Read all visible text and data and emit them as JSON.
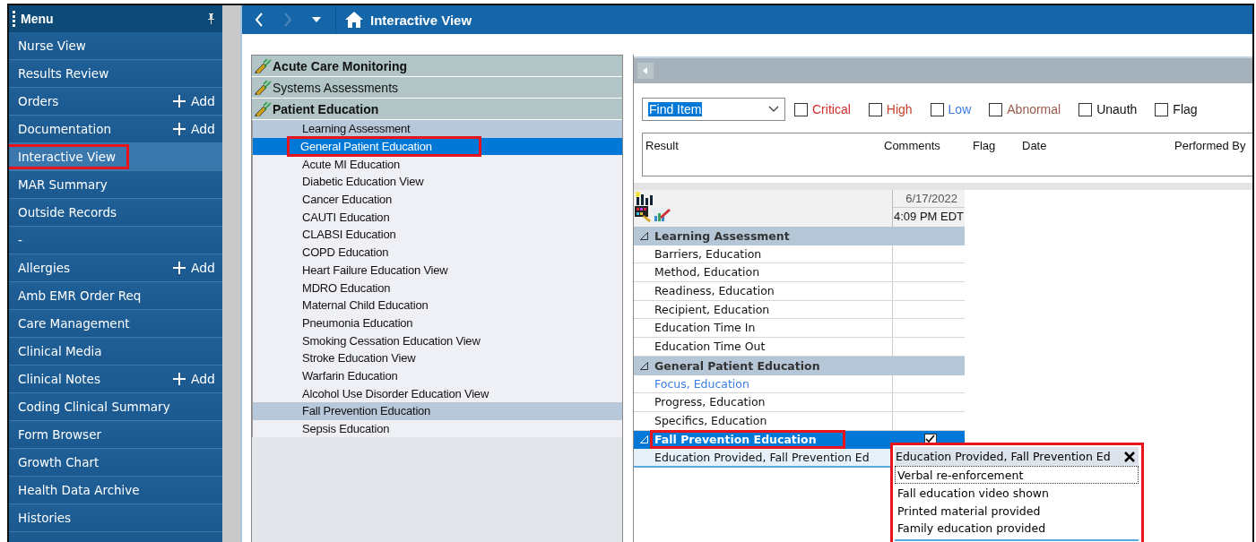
{
  "sidebar": {
    "title": "Menu",
    "items": [
      {
        "label": "Nurse View",
        "selected": false,
        "highlighted": false
      },
      {
        "label": "Results Review",
        "selected": false,
        "highlighted": false
      },
      {
        "label": "Orders",
        "add": "Add",
        "selected": false,
        "highlighted": false
      },
      {
        "label": "Documentation",
        "add": "Add",
        "selected": false,
        "highlighted": false
      },
      {
        "label": "Interactive View",
        "selected": true,
        "highlighted": true
      },
      {
        "label": "MAR Summary",
        "selected": false,
        "highlighted": false
      },
      {
        "label": "Outside Records",
        "selected": false,
        "highlighted": false
      },
      {
        "label": "-",
        "selected": false,
        "highlighted": false
      },
      {
        "label": "Allergies",
        "add": "Add",
        "selected": false,
        "highlighted": false
      },
      {
        "label": "Amb EMR Order Req",
        "selected": false,
        "highlighted": false
      },
      {
        "label": "Care Management",
        "selected": false,
        "highlighted": false
      },
      {
        "label": "Clinical Media",
        "selected": false,
        "highlighted": false
      },
      {
        "label": "Clinical Notes",
        "add": "Add",
        "selected": false,
        "highlighted": false
      },
      {
        "label": "Coding Clinical Summary",
        "selected": false,
        "highlighted": false
      },
      {
        "label": "Form Browser",
        "selected": false,
        "highlighted": false
      },
      {
        "label": "Growth Chart",
        "selected": false,
        "highlighted": false
      },
      {
        "label": "Health Data Archive",
        "selected": false,
        "highlighted": false
      },
      {
        "label": "Histories",
        "selected": false,
        "highlighted": false
      }
    ]
  },
  "toolbar": {
    "title": "Interactive View"
  },
  "bands": [
    {
      "label": "Acute Care Monitoring",
      "documented": true
    },
    {
      "label": "Systems Assessments",
      "documented": false
    },
    {
      "label": "Patient Education",
      "documented": true,
      "items": [
        {
          "label": "Learning Assessment",
          "selected": false,
          "shaded": true,
          "highlighted": false
        },
        {
          "label": "General Patient Education",
          "selected": true,
          "shaded": false,
          "highlighted": true
        },
        {
          "label": "Acute MI Education",
          "selected": false,
          "shaded": false,
          "highlighted": false
        },
        {
          "label": "Diabetic Education View",
          "selected": false,
          "shaded": false,
          "highlighted": false
        },
        {
          "label": "Cancer Education",
          "selected": false,
          "shaded": false,
          "highlighted": false
        },
        {
          "label": "CAUTI Education",
          "selected": false,
          "shaded": false,
          "highlighted": false
        },
        {
          "label": "CLABSI Education",
          "selected": false,
          "shaded": false,
          "highlighted": false
        },
        {
          "label": "COPD Education",
          "selected": false,
          "shaded": false,
          "highlighted": false
        },
        {
          "label": "Heart Failure Education View",
          "selected": false,
          "shaded": false,
          "highlighted": false
        },
        {
          "label": "MDRO Education",
          "selected": false,
          "shaded": false,
          "highlighted": false
        },
        {
          "label": "Maternal Child Education",
          "selected": false,
          "shaded": false,
          "highlighted": false
        },
        {
          "label": "Pneumonia Education",
          "selected": false,
          "shaded": false,
          "highlighted": false
        },
        {
          "label": "Smoking Cessation Education View",
          "selected": false,
          "shaded": false,
          "highlighted": false
        },
        {
          "label": "Stroke Education View",
          "selected": false,
          "shaded": false,
          "highlighted": false
        },
        {
          "label": "Warfarin Education",
          "selected": false,
          "shaded": false,
          "highlighted": false
        },
        {
          "label": "Alcohol Use Disorder Education View",
          "selected": false,
          "shaded": false,
          "highlighted": false
        },
        {
          "label": "Fall Prevention Education",
          "selected": false,
          "shaded": true,
          "highlighted": false
        },
        {
          "label": "Sepsis Education",
          "selected": false,
          "shaded": false,
          "highlighted": false
        }
      ]
    }
  ],
  "filters": {
    "find_item": {
      "value": "Find Item"
    },
    "checkboxes": [
      {
        "label": "Critical",
        "checked": false,
        "color": "#d42a2a"
      },
      {
        "label": "High",
        "checked": false,
        "color": "#c8402a"
      },
      {
        "label": "Low",
        "checked": false,
        "color": "#3b7de6"
      },
      {
        "label": "Abnormal",
        "checked": false,
        "color": "#9a5b4c"
      },
      {
        "label": "Unauth",
        "checked": false,
        "color": "#111111"
      },
      {
        "label": "Flag",
        "checked": false,
        "color": "#111111"
      }
    ]
  },
  "results_table": {
    "columns": [
      "Result",
      "Comments",
      "Flag",
      "Date",
      "Performed By"
    ]
  },
  "flowsheet": {
    "date": "6/17/2022",
    "time": "4:09 PM EDT",
    "sections": [
      {
        "title": "Learning Assessment",
        "selected": false,
        "highlighted": false,
        "rows": [
          {
            "label": "Barriers, Education",
            "kind": "normal"
          },
          {
            "label": "Method, Education",
            "kind": "normal"
          },
          {
            "label": "Readiness, Education",
            "kind": "normal"
          },
          {
            "label": "Recipient, Education",
            "kind": "normal"
          },
          {
            "label": "Education Time In",
            "kind": "normal"
          },
          {
            "label": "Education Time Out",
            "kind": "normal"
          }
        ]
      },
      {
        "title": "General Patient Education",
        "selected": false,
        "highlighted": false,
        "rows": [
          {
            "label": "Focus, Education",
            "kind": "link"
          },
          {
            "label": "Progress, Education",
            "kind": "normal"
          },
          {
            "label": "Specifics, Education",
            "kind": "normal"
          }
        ]
      },
      {
        "title": "Fall Prevention Education",
        "selected": true,
        "highlighted": true,
        "checked": true,
        "rows": [
          {
            "label": "Education Provided, Fall Prevention Ed",
            "kind": "active"
          }
        ]
      }
    ]
  },
  "popup": {
    "title": "Education Provided, Fall Prevention Ed",
    "highlighted": true,
    "options": [
      {
        "label": "Verbal re-enforcement",
        "selected": true
      },
      {
        "label": "Fall education video shown",
        "selected": false
      },
      {
        "label": "Printed material provided",
        "selected": false
      },
      {
        "label": "Family education provided",
        "selected": false
      }
    ]
  }
}
